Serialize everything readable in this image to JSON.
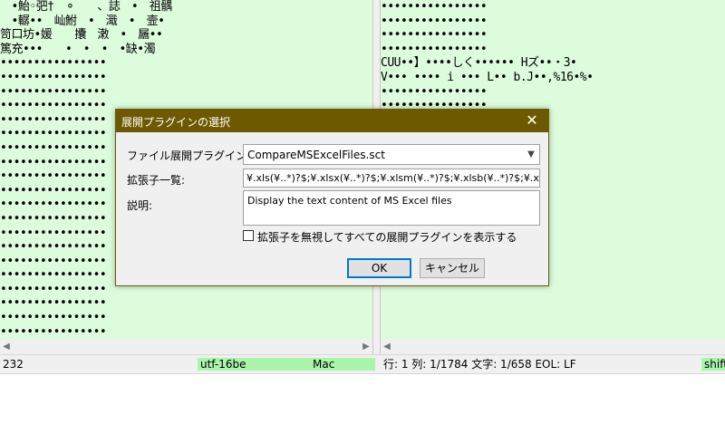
{
  "left_pane": {
    "lines": [
      "　•鮐◦弝†　⚬　　、誌　•　祖髃",
      "　•轏••　屾鮒　•　濈　•　壸•",
      "笥口坊•媛　　攮　潄　•　屫••",
      "篤充•••　　•　•　•　•缺•濁",
      "••••••••••••••••",
      "••••••••••••••••",
      "••••••••••••••••",
      "••••••••••••••••",
      "••••••••••••••••",
      "••••••••••••••••",
      "••••••••••••••••",
      "••••••••••••••••",
      "••••••••••••••••",
      "••••••••••••••••",
      "••••••••••••••••",
      "••••••••••••••••",
      "••••••••••••••••",
      "••••••••••••••••",
      "••••••••••••••••",
      "••••••••••••••••",
      "••••••••••••••••",
      "••••••••••••••••",
      "••••••••••••••••",
      "••••••••••••••••"
    ]
  },
  "right_pane": {
    "lines": [
      "••••••••••••••••",
      "••••••••••••••••",
      "••••••••••••••••",
      "••••••••••••••••",
      "CUU••】••••しく•••••• Hズ••・3•",
      "V••• •••• i ••• L•• b.J••,%16•%•",
      "••••••••••••••••",
      "••••••••••••••••",
      "••••••••••••••••",
      "••••••••••••••••",
      "••••••••••••••••",
      "••••••••••••••••"
    ]
  },
  "status": {
    "left_number": "232",
    "encoding": "utf-16be",
    "eol_mode": "Mac",
    "position": "行: 1  列: 1/1784  文字: 1/658  EOL: LF",
    "right_encoding": "shift"
  },
  "dialog": {
    "title": "展開プラグインの選択",
    "close_glyph": "✕",
    "plugin_label": "ファイル展開プラグイン:",
    "plugin_value": "CompareMSExcelFiles.sct",
    "ext_label": "拡張子一覧:",
    "ext_value": "¥.xls(¥..*)?$;¥.xlsx(¥..*)?$;¥.xlsm(¥..*)?$;¥.xlsb(¥..*)?$;¥.xla(¥..*)?$",
    "desc_label": "説明:",
    "desc_value": "Display the text content of MS Excel files",
    "checkbox_label": "拡張子を無視してすべての展開プラグインを表示する",
    "checkbox_checked": false,
    "ok_label": "OK",
    "cancel_label": "キャンセル"
  },
  "colors": {
    "pane_bg": "#dcfcdc",
    "titlebar": "#6d5a00",
    "status_highlight": "#aaf5aa"
  }
}
